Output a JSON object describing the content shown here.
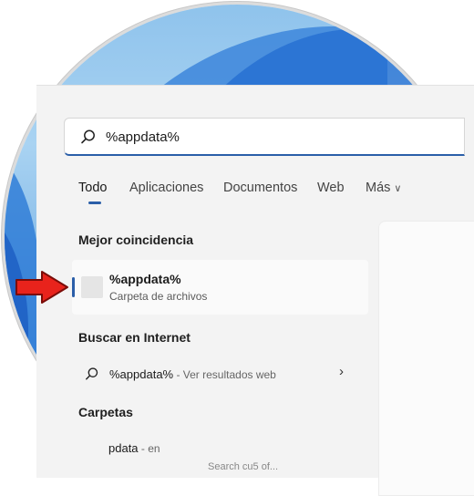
{
  "search": {
    "query": "%appdata%"
  },
  "tabs": [
    {
      "label": "Todo"
    },
    {
      "label": "Aplicaciones"
    },
    {
      "label": "Documentos"
    },
    {
      "label": "Web"
    },
    {
      "label": "Más"
    }
  ],
  "best_match": {
    "heading": "Mejor coincidencia",
    "title": "%appdata%",
    "subtitle": "Carpeta de archivos"
  },
  "internet": {
    "heading": "Buscar en Internet",
    "query": "%appdata%",
    "hint": " - Ver resultados web"
  },
  "folders": {
    "heading": "Carpetas",
    "item_title": "pdata",
    "item_hint": " - en",
    "item_path": "Search cu5 of..."
  },
  "colors": {
    "accent": "#2a5ea8",
    "arrow": "#e8231c"
  }
}
